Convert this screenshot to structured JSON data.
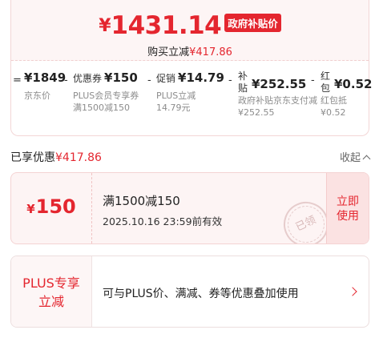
{
  "price_summary": {
    "currency": "¥",
    "final_price": "1431.14",
    "gov_badge": "政府补贴价",
    "save_label": "购买立减",
    "save_amount": "¥417.86"
  },
  "formula": {
    "equals": "=",
    "minus": "-",
    "items": [
      {
        "value": "¥1849",
        "desc": "京东价"
      },
      {
        "prefix": "优惠券",
        "value": "¥150",
        "desc": "PLUS会员专享券 满1500减150"
      },
      {
        "prefix": "促销",
        "value": "¥14.79",
        "desc": "PLUS立减14.79元"
      },
      {
        "prefix": "补贴",
        "value": "¥252.55",
        "desc": "政府补贴京东支付减¥252.55"
      },
      {
        "prefix": "红包",
        "value": "¥0.52",
        "desc": "红包抵¥0.52"
      }
    ]
  },
  "enjoyed": {
    "label": "已享优惠",
    "amount": "¥417.86",
    "collapse_label": "收起"
  },
  "coupon": {
    "currency": "¥",
    "amount": "150",
    "title": "满1500减150",
    "expire": "2025.10.16 23:59前有效",
    "stamp": "已领",
    "action_label": "立即使用"
  },
  "plus": {
    "label": "PLUS专享立减",
    "description": "可与PLUS价、满减、券等优惠叠加使用"
  },
  "colors": {
    "accent": "#e4262f",
    "panel_bg": "#fdf4f4"
  }
}
